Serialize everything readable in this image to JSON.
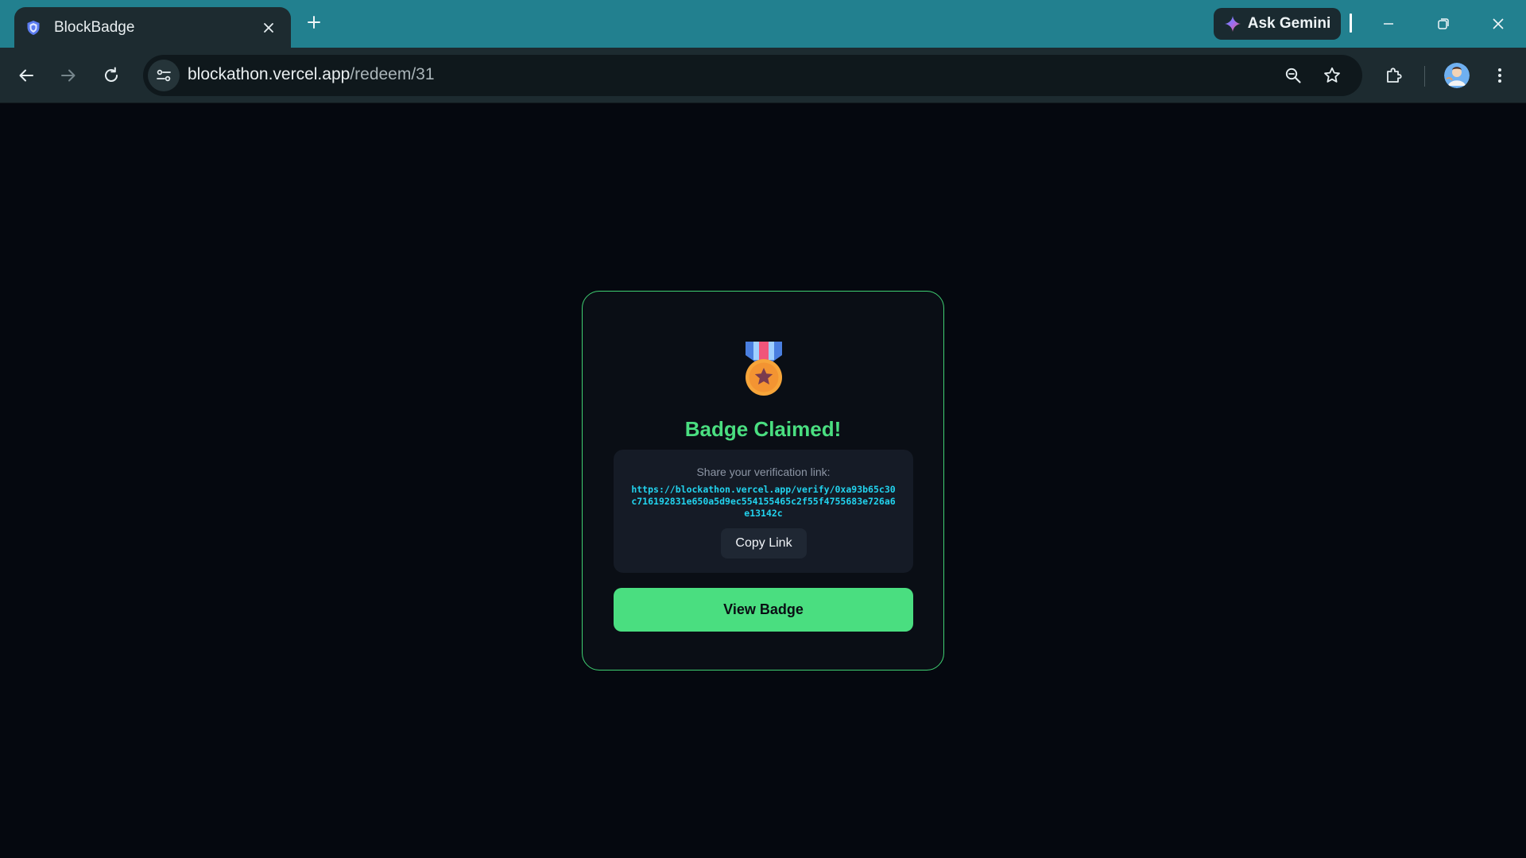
{
  "browser": {
    "tab_title": "BlockBadge",
    "url_host": "blockathon.vercel.app",
    "url_path": "/redeem/31",
    "gemini_label": "Ask Gemini"
  },
  "colors": {
    "accent": "#4ade80",
    "link": "#22d3ee",
    "titlebar": "#22808f",
    "page_bg": "#05080f"
  },
  "icons": {
    "favicon": "shield-icon",
    "badge": "medal-icon"
  },
  "card": {
    "heading": "Badge Claimed!",
    "share_label": "Share your verification link:",
    "share_link": "https://blockathon.vercel.app/verify/0xa93b65c30c716192831e650a5d9ec554155465c2f55f4755683e726a6e13142c",
    "copy_label": "Copy Link",
    "view_label": "View Badge"
  }
}
